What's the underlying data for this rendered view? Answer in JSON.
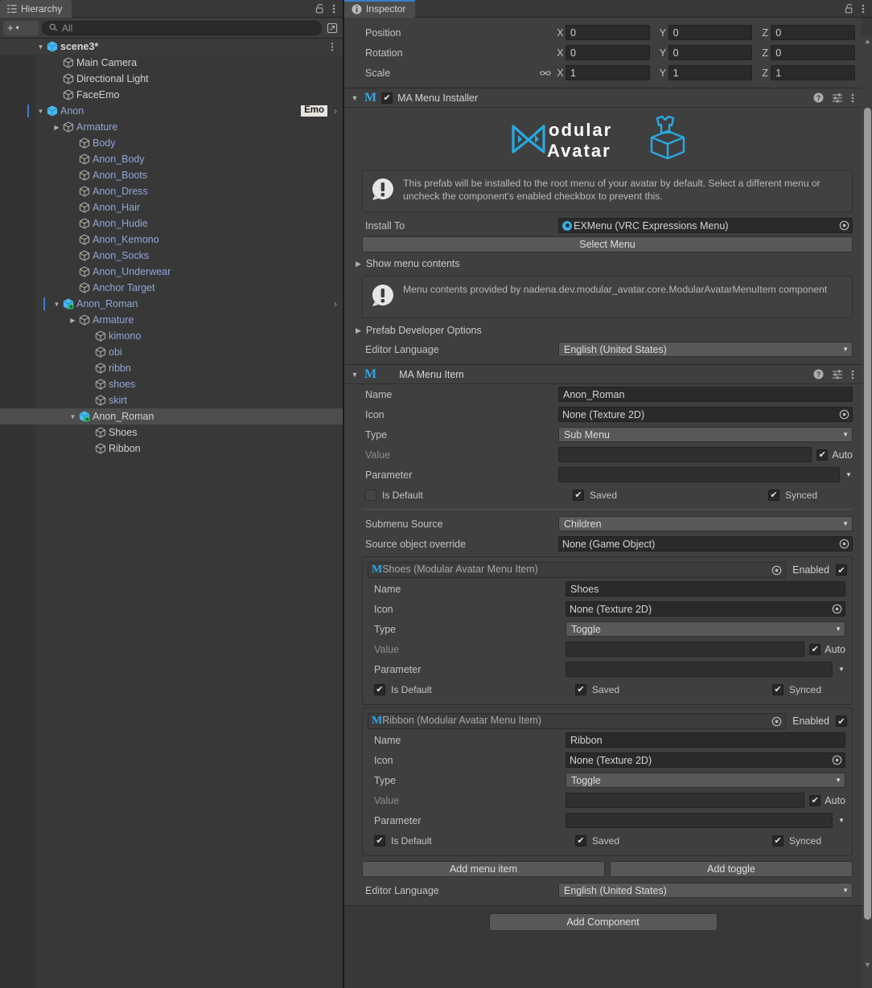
{
  "hierarchy": {
    "tab_label": "Hierarchy",
    "tab_icon": "hierarchy-icon",
    "lock_icon": "lock-open-icon",
    "menu_icon": "kebab-menu-icon",
    "toolbar": {
      "create_label": "+",
      "create_dropdown_arrow": "▾",
      "search_placeholder": "All",
      "search_value": "",
      "search_icon": "search-icon",
      "expand_icon": "open-in-new-icon"
    },
    "scene": {
      "name": "scene3*",
      "twisty": "▼",
      "row_menu": "⋮"
    },
    "items": [
      {
        "label": "Main Camera",
        "depth": 2,
        "twisty": "",
        "icon": "cube-icon",
        "color": "white",
        "badge": "",
        "chevron": false
      },
      {
        "label": "Directional Light",
        "depth": 2,
        "twisty": "",
        "icon": "cube-icon",
        "color": "white",
        "badge": "",
        "chevron": false
      },
      {
        "label": "FaceEmo",
        "depth": 2,
        "twisty": "",
        "icon": "cube-icon",
        "color": "white",
        "badge": "",
        "chevron": false
      },
      {
        "label": "Anon",
        "depth": 1,
        "twisty": "▼",
        "icon": "prefab-cube-icon",
        "color": "prefab",
        "badge": "Emo",
        "chevron": true
      },
      {
        "label": "Armature",
        "depth": 2,
        "twisty": "▶",
        "icon": "cube-icon",
        "color": "prefab",
        "badge": "",
        "chevron": false
      },
      {
        "label": "Body",
        "depth": 3,
        "twisty": "",
        "icon": "cube-icon",
        "color": "prefab",
        "badge": "",
        "chevron": false
      },
      {
        "label": "Anon_Body",
        "depth": 3,
        "twisty": "",
        "icon": "cube-icon",
        "color": "prefab",
        "badge": "",
        "chevron": false
      },
      {
        "label": "Anon_Boots",
        "depth": 3,
        "twisty": "",
        "icon": "cube-icon",
        "color": "prefab",
        "badge": "",
        "chevron": false
      },
      {
        "label": "Anon_Dress",
        "depth": 3,
        "twisty": "",
        "icon": "cube-icon",
        "color": "prefab",
        "badge": "",
        "chevron": false
      },
      {
        "label": "Anon_Hair",
        "depth": 3,
        "twisty": "",
        "icon": "cube-icon",
        "color": "prefab",
        "badge": "",
        "chevron": false
      },
      {
        "label": "Anon_Hudie",
        "depth": 3,
        "twisty": "",
        "icon": "cube-icon",
        "color": "prefab",
        "badge": "",
        "chevron": false
      },
      {
        "label": "Anon_Kemono",
        "depth": 3,
        "twisty": "",
        "icon": "cube-icon",
        "color": "prefab",
        "badge": "",
        "chevron": false
      },
      {
        "label": "Anon_Socks",
        "depth": 3,
        "twisty": "",
        "icon": "cube-icon",
        "color": "prefab",
        "badge": "",
        "chevron": false
      },
      {
        "label": "Anon_Underwear",
        "depth": 3,
        "twisty": "",
        "icon": "cube-icon",
        "color": "prefab",
        "badge": "",
        "chevron": false
      },
      {
        "label": "Anchor Target",
        "depth": 3,
        "twisty": "",
        "icon": "cube-icon",
        "color": "prefab",
        "badge": "",
        "chevron": false
      },
      {
        "label": "Anon_Roman",
        "depth": 2,
        "twisty": "▼",
        "icon": "prefab-variant-icon",
        "color": "prefab",
        "badge": "",
        "chevron": true
      },
      {
        "label": "Armature",
        "depth": 3,
        "twisty": "▶",
        "icon": "cube-icon",
        "color": "prefab",
        "badge": "",
        "chevron": false
      },
      {
        "label": "kimono",
        "depth": 4,
        "twisty": "",
        "icon": "cube-icon",
        "color": "prefab",
        "badge": "",
        "chevron": false
      },
      {
        "label": "obi",
        "depth": 4,
        "twisty": "",
        "icon": "cube-icon",
        "color": "prefab",
        "badge": "",
        "chevron": false
      },
      {
        "label": "ribbn",
        "depth": 4,
        "twisty": "",
        "icon": "cube-icon",
        "color": "prefab",
        "badge": "",
        "chevron": false
      },
      {
        "label": "shoes",
        "depth": 4,
        "twisty": "",
        "icon": "cube-icon",
        "color": "prefab",
        "badge": "",
        "chevron": false
      },
      {
        "label": "skirt",
        "depth": 4,
        "twisty": "",
        "icon": "cube-icon",
        "color": "prefab",
        "badge": "",
        "chevron": false
      },
      {
        "label": "Anon_Roman",
        "depth": 3,
        "twisty": "▼",
        "icon": "prefab-variant-icon",
        "color": "white",
        "badge": "",
        "chevron": false,
        "selected": true
      },
      {
        "label": "Shoes",
        "depth": 4,
        "twisty": "",
        "icon": "cube-icon",
        "color": "white",
        "badge": "",
        "chevron": false
      },
      {
        "label": "Ribbon",
        "depth": 4,
        "twisty": "",
        "icon": "cube-icon",
        "color": "white",
        "badge": "",
        "chevron": false
      }
    ]
  },
  "inspector": {
    "tab_label": "Inspector",
    "tab_icon": "info-icon",
    "lock_icon": "lock-open-icon",
    "menu_icon": "kebab-menu-icon",
    "transform": {
      "rows": [
        {
          "label": "Position",
          "x": "0",
          "y": "0",
          "z": "0",
          "link": false
        },
        {
          "label": "Rotation",
          "x": "0",
          "y": "0",
          "z": "0",
          "link": false
        },
        {
          "label": "Scale",
          "x": "1",
          "y": "1",
          "z": "1",
          "link": true
        }
      ],
      "axis_x": "X",
      "axis_y": "Y",
      "axis_z": "Z"
    },
    "menu_installer": {
      "fold": "▼",
      "component_glyph": "M",
      "enabled": true,
      "title": "MA Menu Installer",
      "help_icon": "help-icon",
      "preset_icon": "preset-icon",
      "kebab_icon": "kebab-menu-icon",
      "logo": {
        "mark": "butterfly-mark",
        "line1": "odular",
        "line2": "Avatar",
        "box": "avatar-box-icon"
      },
      "notice": "This prefab will be installed to the root menu of your avatar by default. Select a different menu or uncheck the component's enabled checkbox to prevent this.",
      "install_to_label": "Install To",
      "install_to_value": "EXMenu (VRC Expressions Menu)",
      "install_to_icon": "vrc-menu-icon",
      "select_menu_button": "Select Menu",
      "show_menu_contents_label": "Show menu contents",
      "show_menu_contents_fold": "▶",
      "menu_contents_notice": "Menu contents provided by nadena.dev.modular_avatar.core.ModularAvatarMenuItem component",
      "prefab_dev_options_label": "Prefab Developer Options",
      "prefab_dev_options_fold": "▶",
      "editor_language_label": "Editor Language",
      "editor_language_value": "English (United States)"
    },
    "menu_item": {
      "fold": "▼",
      "component_glyph": "M",
      "title": "MA Menu Item",
      "help_icon": "help-icon",
      "preset_icon": "preset-icon",
      "kebab_icon": "kebab-menu-icon",
      "name_label": "Name",
      "name_value": "Anon_Roman",
      "icon_label": "Icon",
      "icon_value": "None (Texture 2D)",
      "type_label": "Type",
      "type_value": "Sub Menu",
      "value_label": "Value",
      "value_value": "",
      "auto_label": "Auto",
      "auto_checked": true,
      "parameter_label": "Parameter",
      "parameter_value": "",
      "is_default_label": "Is Default",
      "is_default_checked": false,
      "saved_label": "Saved",
      "saved_checked": true,
      "synced_label": "Synced",
      "synced_checked": true,
      "submenu_source_label": "Submenu Source",
      "submenu_source_value": "Children",
      "source_object_override_label": "Source object override",
      "source_object_override_value": "None (Game Object)",
      "children": [
        {
          "header_glyph": "M",
          "header_text": "Shoes (Modular Avatar Menu Item)",
          "enabled_label": "Enabled",
          "enabled_checked": true,
          "name_label": "Name",
          "name_value": "Shoes",
          "icon_label": "Icon",
          "icon_value": "None (Texture 2D)",
          "type_label": "Type",
          "type_value": "Toggle",
          "value_label": "Value",
          "value_value": "",
          "auto_label": "Auto",
          "auto_checked": true,
          "parameter_label": "Parameter",
          "parameter_value": "",
          "is_default_label": "Is Default",
          "is_default_checked": true,
          "saved_label": "Saved",
          "saved_checked": true,
          "synced_label": "Synced",
          "synced_checked": true
        },
        {
          "header_glyph": "M",
          "header_text": "Ribbon (Modular Avatar Menu Item)",
          "enabled_label": "Enabled",
          "enabled_checked": true,
          "name_label": "Name",
          "name_value": "Ribbon",
          "icon_label": "Icon",
          "icon_value": "None (Texture 2D)",
          "type_label": "Type",
          "type_value": "Toggle",
          "value_label": "Value",
          "value_value": "",
          "auto_label": "Auto",
          "auto_checked": true,
          "parameter_label": "Parameter",
          "parameter_value": "",
          "is_default_label": "Is Default",
          "is_default_checked": true,
          "saved_label": "Saved",
          "saved_checked": true,
          "synced_label": "Synced",
          "synced_checked": true
        }
      ],
      "add_menu_item_button": "Add menu item",
      "add_toggle_button": "Add toggle",
      "editor_language_label": "Editor Language",
      "editor_language_value": "English (United States)"
    },
    "add_component_button": "Add Component"
  },
  "colors": {
    "accent_blue": "#2ea6e8",
    "tab_selected_underline": "#3d7cc9",
    "prefab_text": "#8fa8d8",
    "panel_bg": "#383838",
    "field_bg": "#2a2a2a"
  }
}
